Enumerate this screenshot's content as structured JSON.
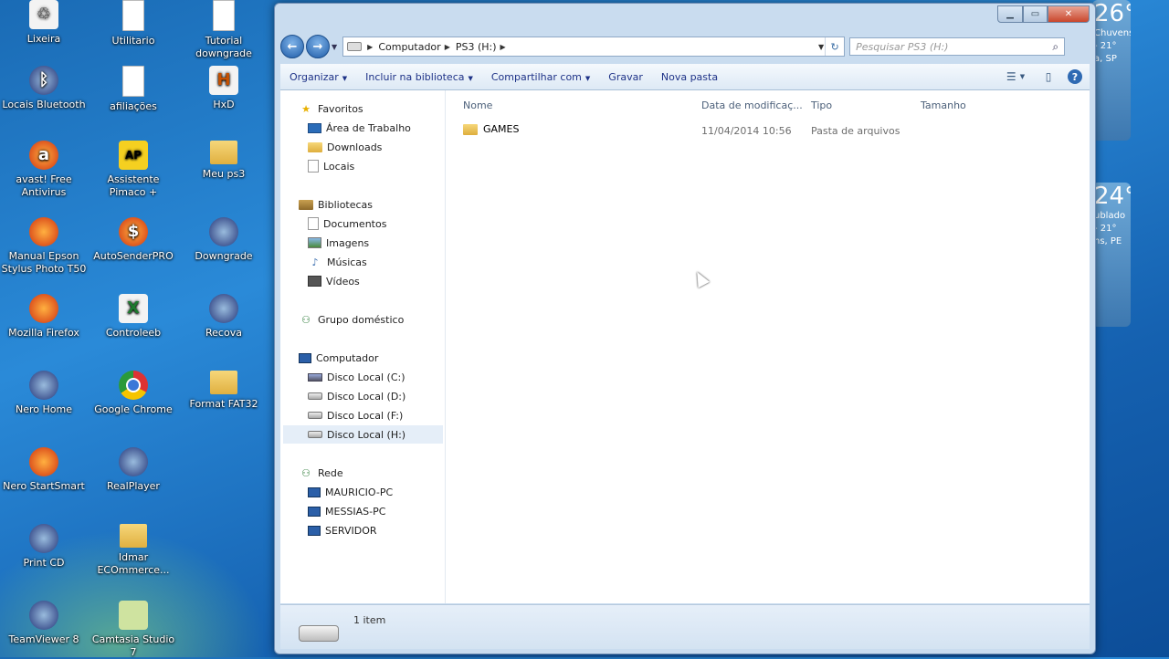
{
  "desktop": {
    "icons": [
      {
        "label": "Lixeira",
        "icon": "recycle-bin-icon"
      },
      {
        "label": "Utilitario",
        "icon": "file-icon"
      },
      {
        "label": "Tutorial downgrade",
        "icon": "file-icon"
      },
      {
        "label": "Locais Bluetooth",
        "icon": "bluetooth-icon"
      },
      {
        "label": "afiliações",
        "icon": "file-icon"
      },
      {
        "label": "HxD",
        "icon": "hxd-icon"
      },
      {
        "label": "avast! Free Antivirus",
        "icon": "avast-icon"
      },
      {
        "label": "Assistente Pimaco +",
        "icon": "pimaco-icon"
      },
      {
        "label": "Meu ps3",
        "icon": "folder-icon"
      },
      {
        "label": "Manual Epson Stylus Photo T50",
        "icon": "firefox-doc-icon"
      },
      {
        "label": "AutoSenderPRO",
        "icon": "autosender-icon"
      },
      {
        "label": "Downgrade",
        "icon": "downgrade-icon"
      },
      {
        "label": "Mozilla Firefox",
        "icon": "firefox-icon"
      },
      {
        "label": "Controleeb",
        "icon": "excel-icon"
      },
      {
        "label": "Recova",
        "icon": "recova-icon"
      },
      {
        "label": "Nero Home",
        "icon": "nero-icon"
      },
      {
        "label": "Google Chrome",
        "icon": "chrome-icon"
      },
      {
        "label": "Format FAT32",
        "icon": "folder-icon"
      },
      {
        "label": "Nero StartSmart",
        "icon": "nero-icon"
      },
      {
        "label": "RealPlayer",
        "icon": "realplayer-icon"
      },
      {
        "label": "Print CD",
        "icon": "nero-icon"
      },
      {
        "label": "Idmar ECOmmerce...",
        "icon": "folder-icon"
      },
      {
        "label": "TeamViewer 8",
        "icon": "teamviewer-icon"
      },
      {
        "label": "Camtasia Studio 7",
        "icon": "camtasia-icon"
      }
    ]
  },
  "weather": {
    "top": {
      "temp": "26°",
      "line1": "Chuvens",
      "line2": "- 21°",
      "line3": "a, SP"
    },
    "bottom": {
      "temp": "24°",
      "line1": "ublado",
      "line2": "- 21°",
      "line3": "ns, PE"
    }
  },
  "window": {
    "address": {
      "segments": [
        "Computador",
        "PS3 (H:)"
      ]
    },
    "search_placeholder": "Pesquisar PS3 (H:)",
    "toolbar": {
      "organize": "Organizar",
      "include": "Incluir na biblioteca",
      "share": "Compartilhar com",
      "burn": "Gravar",
      "new_folder": "Nova pasta"
    },
    "nav": {
      "favorites": "Favoritos",
      "desktop": "Área de Trabalho",
      "downloads": "Downloads",
      "locais": "Locais",
      "libraries": "Bibliotecas",
      "documents": "Documentos",
      "images": "Imagens",
      "music": "Músicas",
      "videos": "Vídeos",
      "homegroup": "Grupo doméstico",
      "computer": "Computador",
      "disk_c": "Disco Local (C:)",
      "disk_d": "Disco Local (D:)",
      "disk_f": "Disco Local (F:)",
      "disk_h": "Disco Local (H:)",
      "network": "Rede",
      "pc1": "MAURICIO-PC",
      "pc2": "MESSIAS-PC",
      "pc3": "SERVIDOR"
    },
    "columns": {
      "name": "Nome",
      "date": "Data de modificaç...",
      "type": "Tipo",
      "size": "Tamanho"
    },
    "files": [
      {
        "name": "GAMES",
        "date": "11/04/2014 10:56",
        "type": "Pasta de arquivos",
        "size": ""
      }
    ],
    "status": {
      "count": "1 item"
    }
  }
}
